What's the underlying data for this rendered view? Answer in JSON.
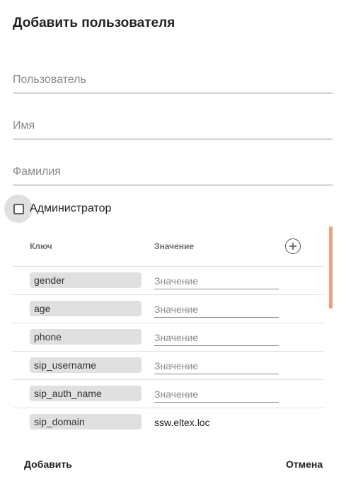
{
  "dialog": {
    "title": "Добавить пользователя"
  },
  "fields": {
    "username_placeholder": "Пользователь",
    "first_name_placeholder": "Имя",
    "last_name_placeholder": "Фамилия"
  },
  "admin_checkbox": {
    "label": "Администратор",
    "checked": false
  },
  "attributes": {
    "key_header": "Ключ",
    "value_header": "Значение",
    "add_icon": "plus-circle-icon",
    "value_placeholder": "Значение",
    "rows": [
      {
        "key": "gender",
        "value": ""
      },
      {
        "key": "age",
        "value": ""
      },
      {
        "key": "phone",
        "value": ""
      },
      {
        "key": "sip_username",
        "value": ""
      },
      {
        "key": "sip_auth_name",
        "value": ""
      },
      {
        "key": "sip_domain",
        "value": "ssw.eltex.loc"
      }
    ]
  },
  "actions": {
    "add_label": "Добавить",
    "cancel_label": "Отмена"
  },
  "colors": {
    "scrollbar_thumb": "#f0a07a",
    "chip_background": "#e0e0e0"
  }
}
